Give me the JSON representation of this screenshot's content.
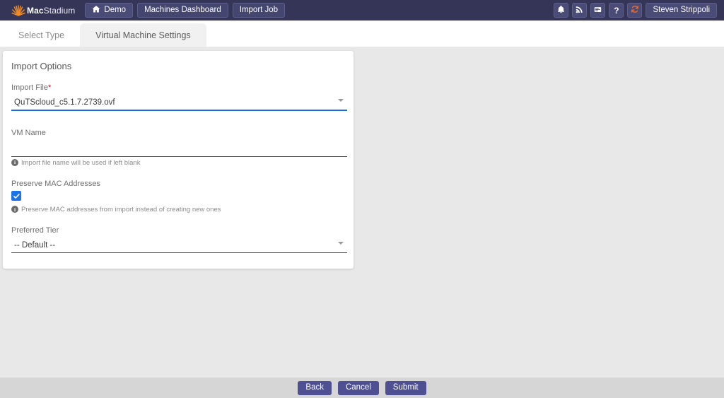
{
  "topbar": {
    "brand": {
      "mark": "sunburst-icon",
      "name_bold": "Mac",
      "name_light": "Stadium"
    },
    "nav": [
      {
        "label": "Demo",
        "icon": "home-icon"
      },
      {
        "label": "Machines Dashboard",
        "icon": ""
      },
      {
        "label": "Import Job",
        "icon": ""
      }
    ],
    "actions": [
      {
        "name": "notifications",
        "icon": "bell-icon"
      },
      {
        "name": "feed",
        "icon": "rss-icon"
      },
      {
        "name": "tasks",
        "icon": "list-icon"
      },
      {
        "name": "help",
        "icon": "question-mark-icon"
      },
      {
        "name": "refresh",
        "icon": "refresh-icon"
      }
    ],
    "user": "Steven Strippoli",
    "colors": {
      "bar": "#353657",
      "button": "#4a4b77",
      "accent_orange": "#ef6c2a"
    }
  },
  "tabs": [
    {
      "label": "Select Type",
      "active": false
    },
    {
      "label": "Virtual Machine Settings",
      "active": true
    }
  ],
  "card": {
    "title": "Import Options",
    "import_file": {
      "label": "Import File",
      "required_marker": "*",
      "value": "QuTScloud_c5.1.7.2739.ovf",
      "chevron": "chevron-down-icon"
    },
    "vm_name": {
      "label": "VM Name",
      "value": "",
      "placeholder": "",
      "hint": "Import file name will be used if left blank",
      "hint_icon": "info-icon"
    },
    "preserve_mac": {
      "label": "Preserve MAC Addresses",
      "checked": true,
      "hint": "Preserve MAC addresses from import instead of creating new ones",
      "hint_icon": "info-icon"
    },
    "preferred_tier": {
      "label": "Preferred Tier",
      "value": "-- Default --",
      "chevron": "chevron-down-icon"
    }
  },
  "footer": {
    "buttons": [
      {
        "label": "Back"
      },
      {
        "label": "Cancel"
      },
      {
        "label": "Submit"
      }
    ],
    "button_color": "#4e5093"
  }
}
